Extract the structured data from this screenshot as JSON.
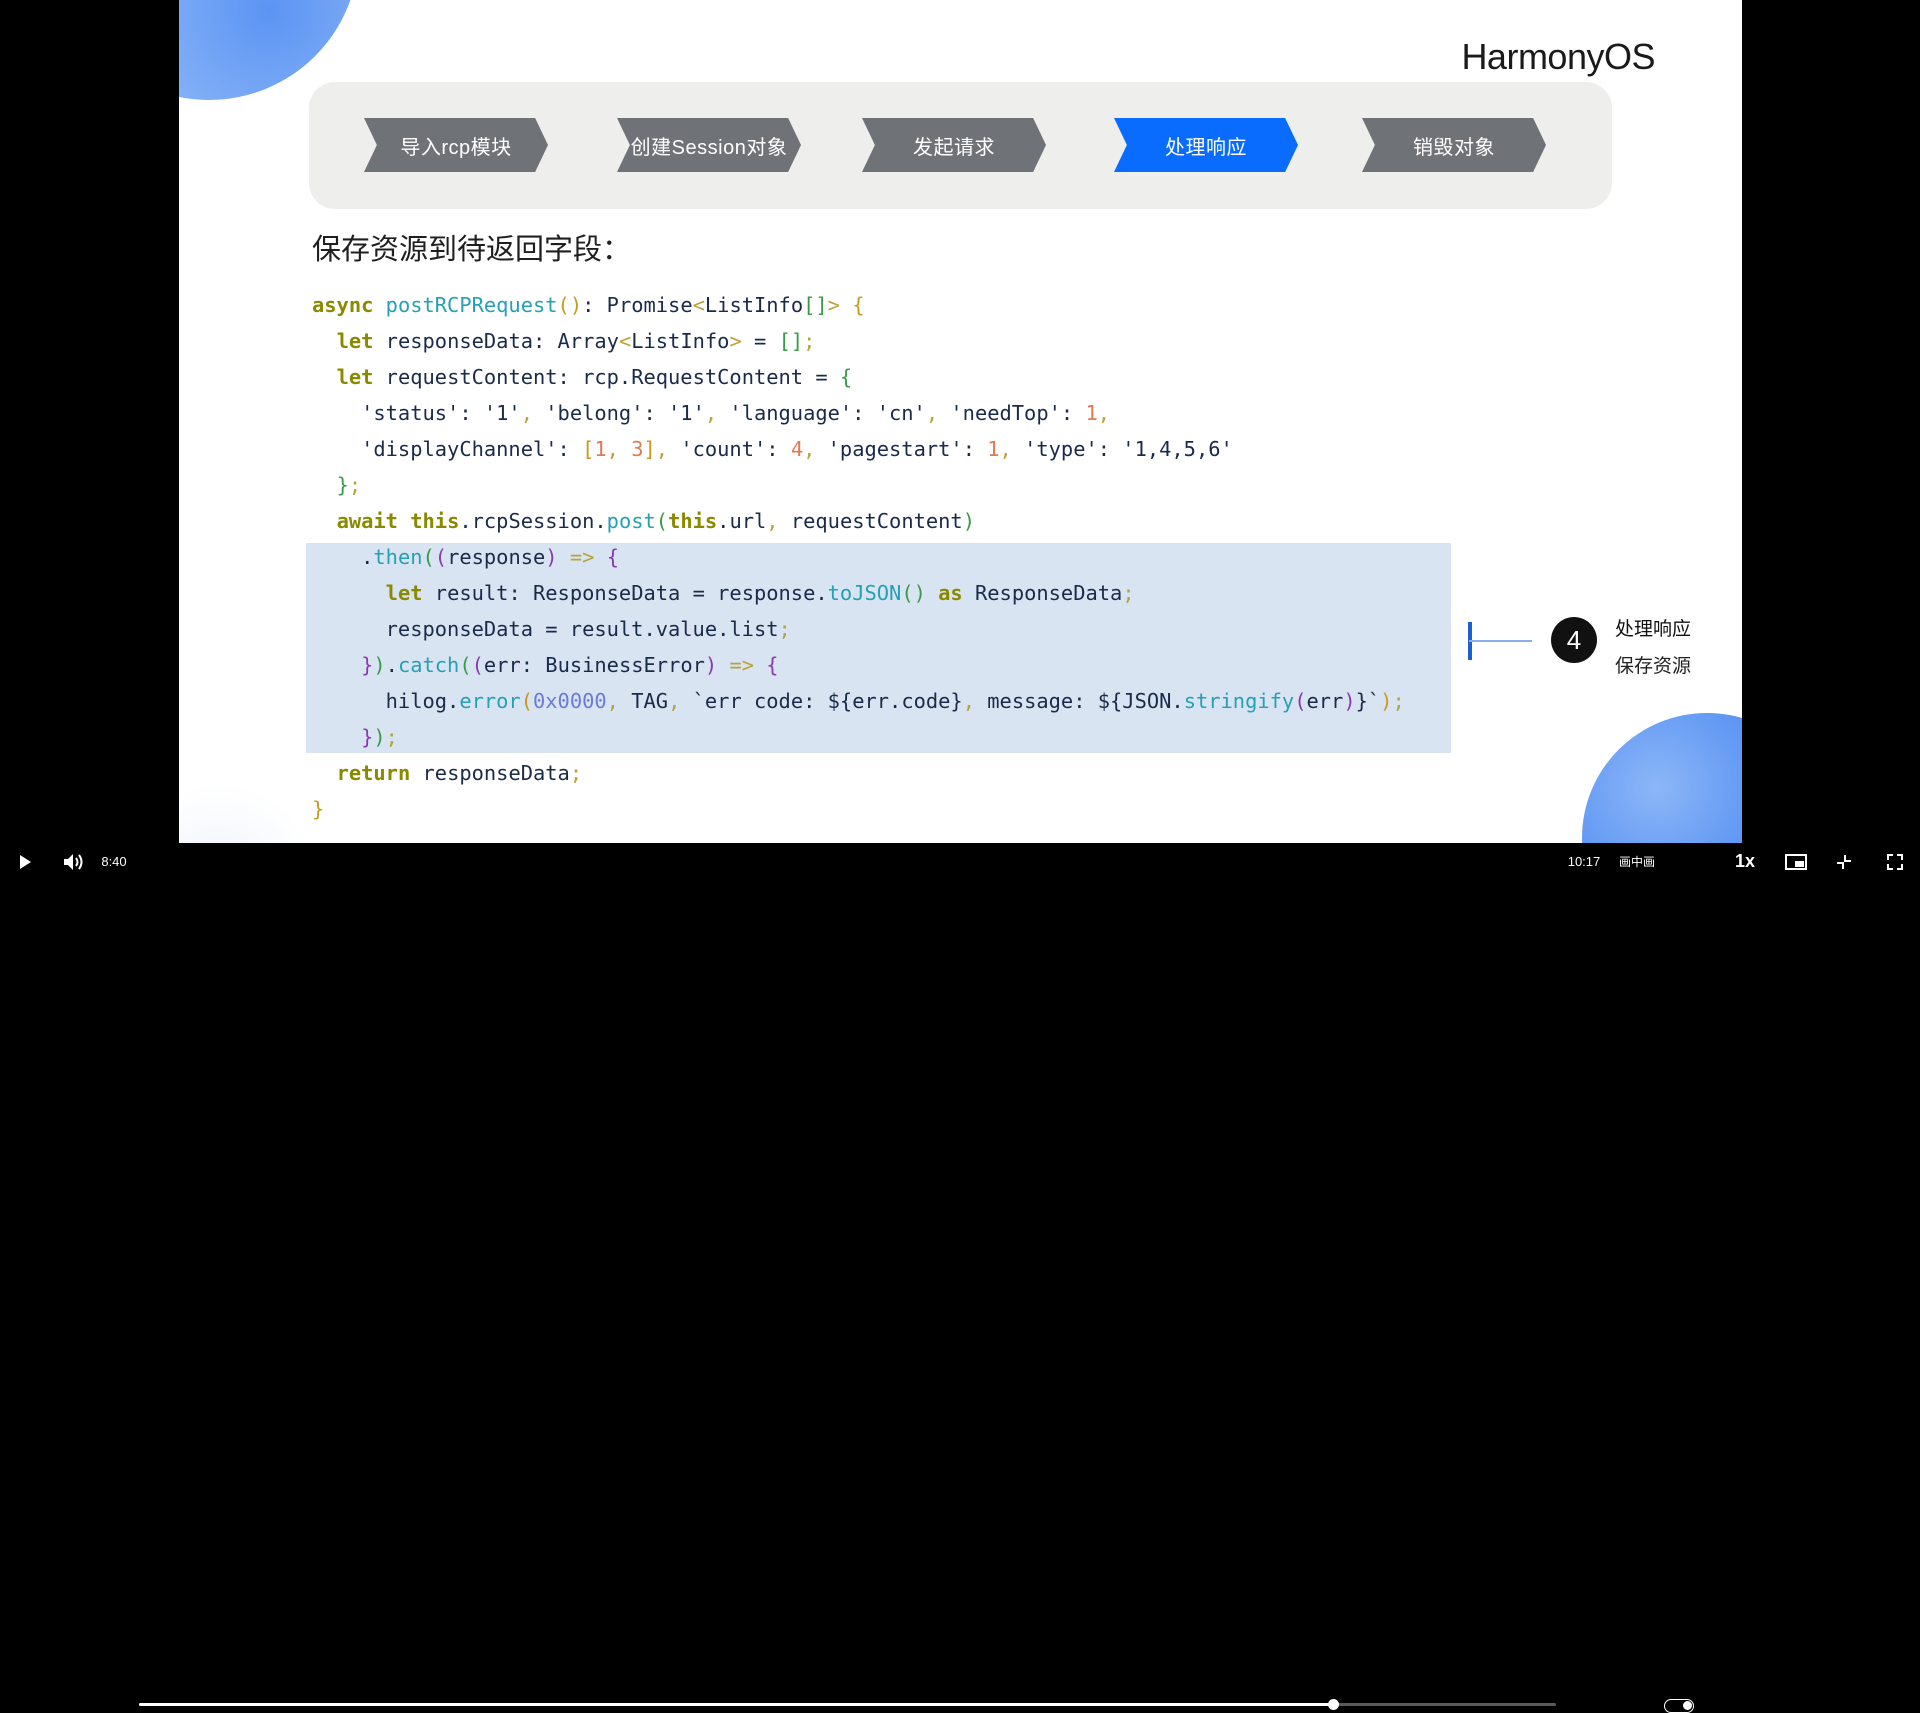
{
  "slide": {
    "logo": "HarmonyOS",
    "steps": [
      {
        "label": "导入rcp模块",
        "active": false
      },
      {
        "label": "创建Session对象",
        "active": false
      },
      {
        "label": "发起请求",
        "active": false
      },
      {
        "label": "处理响应",
        "active": true
      },
      {
        "label": "销毁对象",
        "active": false
      }
    ],
    "heading": "保存资源到待返回字段：",
    "annotation": {
      "number": "4",
      "title": "处理响应",
      "subtitle": "保存资源"
    }
  },
  "player": {
    "current_time": "8:40",
    "duration": "10:17",
    "progress": 0.8425,
    "pip_label": "画中画",
    "speed_label": "1x"
  },
  "colors": {
    "active_step": "#0a6cff",
    "step": "#6f7378",
    "accent": "#1b5fd3",
    "highlight": "#d9e4f2"
  },
  "icons": [
    "play-icon",
    "volume-icon",
    "toggle-icon",
    "mini-player-icon",
    "exit-fullscreen-icon",
    "fullscreen-icon"
  ]
}
